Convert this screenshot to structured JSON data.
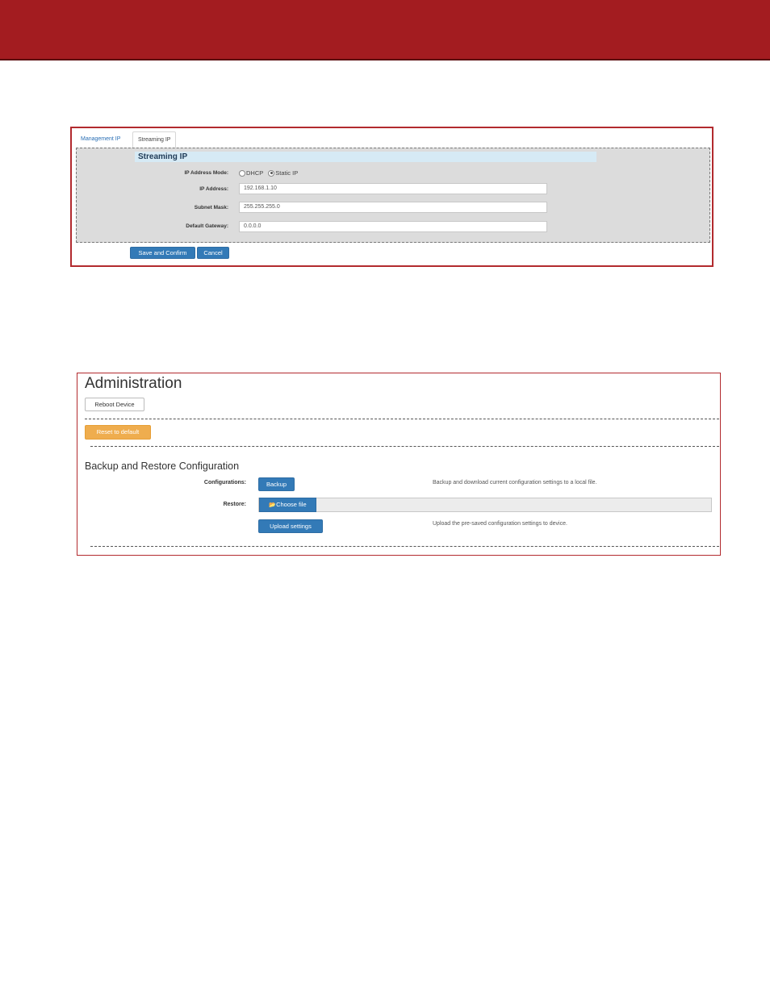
{
  "streaming_ip_panel": {
    "tabs": [
      {
        "label": "Management IP",
        "active": false
      },
      {
        "label": "Streaming IP",
        "active": true
      }
    ],
    "section_title": "Streaming IP",
    "ip_mode": {
      "label": "IP Address Mode:",
      "options": [
        {
          "label": "DHCP",
          "selected": false
        },
        {
          "label": "Static IP",
          "selected": true
        }
      ]
    },
    "ip_address": {
      "label": "IP Address:",
      "value": "192.168.1.10"
    },
    "subnet_mask": {
      "label": "Subnet Mask:",
      "value": "255.255.255.0"
    },
    "default_gateway": {
      "label": "Default Gateway:",
      "value": "0.0.0.0"
    },
    "buttons": {
      "save": "Save and Confirm",
      "cancel": "Cancel"
    }
  },
  "administration_panel": {
    "title": "Administration",
    "reboot_button": "Reboot Device",
    "reset_button": "Reset to default",
    "backup_restore_title": "Backup and Restore Configuration",
    "configurations_label": "Configurations:",
    "backup_button": "Backup",
    "backup_help": "Backup and download current configuration settings to a local file.",
    "restore_label": "Restore:",
    "choose_file_button": "Choose file",
    "upload_button": "Upload settings",
    "upload_help": "Upload the pre-saved configuration settings to device."
  },
  "colors": {
    "banner": "#a31c20",
    "panel_border": "#b22a2e",
    "primary_button": "#337ab7",
    "warning_button": "#efad4e",
    "section_header_bg": "#d6eaf5",
    "form_bg": "#dcdcdc"
  }
}
